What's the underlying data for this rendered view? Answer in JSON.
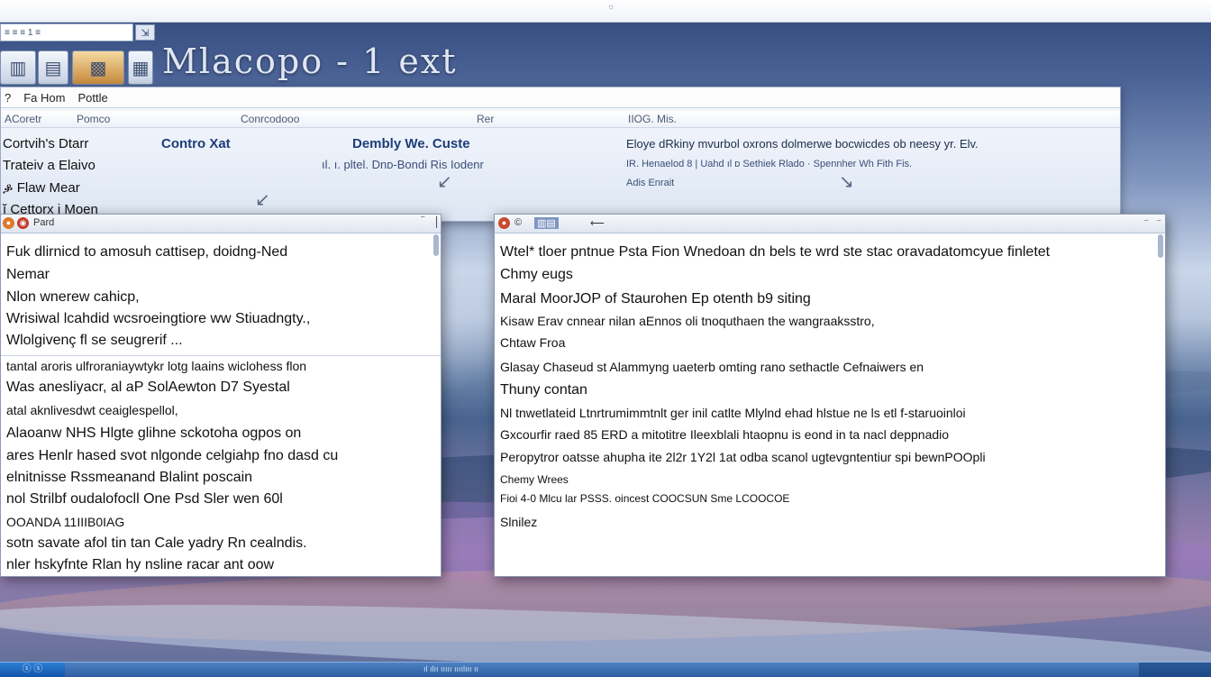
{
  "app": {
    "title": "Mlacopo - 1 ext",
    "top_mark": "☼",
    "address_value": "≡ ≡ ≡ 1 ≡",
    "go_button": "⇲"
  },
  "toolbar_icons": [
    {
      "name": "bar-chart-icon",
      "glyph": "▥"
    },
    {
      "name": "book-icon",
      "glyph": "▤"
    },
    {
      "name": "document-icon",
      "glyph": "▦"
    },
    {
      "name": "image-icon",
      "glyph": "▩"
    },
    {
      "name": "folder-icon",
      "glyph": "▨"
    }
  ],
  "explorer": {
    "menu": [
      "?",
      "Fa Hom",
      "Pottle"
    ],
    "columns": [
      "ACoretr",
      "Pomco",
      "Conrcodooo",
      "Rer",
      "IIOG. Mis."
    ],
    "left_rows": [
      "Cortvih's Dtarr",
      "Trateiv a Elaivo",
      "ቇ Flaw Mear",
      "ĭ Cettorx i Moen"
    ],
    "row_title_1": "Contro Xat",
    "row_title_2": "Dembly We. Custe",
    "row_sub_2": "ıl. ı. pltel. Dnᴅ-Bondi Ris Iodenr",
    "right_row_1": "Eloye dRkiny mvurbol oxrons dolmerwe bocwicdes ob neesy yr. Elv.",
    "right_row_2": "IR. Henaelod 8 | Uahd ıl ᴅ Sethiek Rlado · Spennher Wh Fith Fis.",
    "right_row_3": "Adis Enrait"
  },
  "left_window": {
    "title": "Pard",
    "lines_top": [
      "Fuk dlirnicd to amosuh cattisep, doidng-Ned",
      "Nemar",
      "Nlon wnerew cahicp,",
      "Wrisiwal lcahdid wcsroeingtiore ww Stiuadngty.,",
      "Wlolgivenç fl se seugrerif ..."
    ],
    "lines_bottom": [
      "tantal aroris ulfroraniaywtykr lotg laains wiclohess flon",
      "Was anesliyacr, al aP SolAewton D7 Syestal",
      "atal aknlivesdwt ceaiglespellol,",
      "Alaoanw NHS Hlgte glihne sckotoha ogpos on",
      "ares Henlr hased svot nlgonde celgiahp fno dasd cu",
      "elnitnisse Rssmeanand Blalint poscain",
      "nol Strilbf oudalofocll One Psd Sler wen 60l",
      "OOANDA 11IIIB0IAG",
      "sotn savate afol tin tan Cale yadry Rn cealndis.",
      "nler hskyfnte Rlan hy nsline racar ant oow"
    ]
  },
  "right_window": {
    "title": "",
    "lines": [
      "Wtel* tloer pntnue Psta Fion Wnedoan dn bels te wrd ste stac oravadatomcyue finletet",
      "Chmy eugs",
      "Maral MoorJOP of Staurohen Ep otenth b9 siting",
      "Kisaw Erav cnnear nilan aEnnos oli tnoquthaen the wangraaksstro,",
      "Chtaw Froa",
      "Glasay Chaseud st Alammyng uaeterb omting rano sethactle Cefnaiwers en",
      "Thuny contan",
      "Nl tnwetlateid Ltnrtrumimmtnlt ger inil catlte Mlylnd ehad hlstue ne ls etl f-staruoinloi",
      "Gxcourfir raed 85 ERD a mitotitre Ileexblali htaopnu is eond in ta nacl deppnadio",
      "Peropytror oatsse ahupha ite 2l2r 1Y2l 1at odba scanol ugtevgntentiur spi bewnPOOpli",
      "Chemy Wrees",
      "Fioi 4-0 Mlcu lar PSSS. oincest COOCSUN Sme LCOOCOE",
      "Slnilez"
    ]
  },
  "taskbar": {
    "start_label": "ⓢ ⓢ",
    "center_text": "ıl ılıı ııııı ıııılııı ıı"
  }
}
